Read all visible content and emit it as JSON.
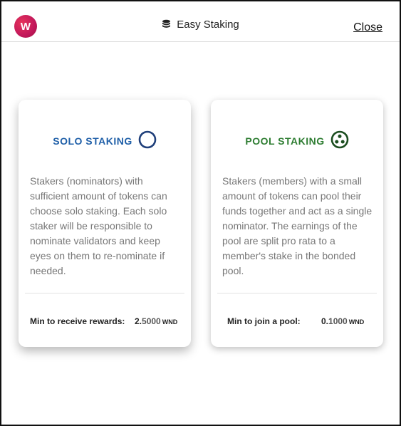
{
  "header": {
    "logo_letter": "W",
    "title": "Easy Staking",
    "close_label": "Close"
  },
  "cards": [
    {
      "title": "SOLO STAKING",
      "icon": "circle-icon",
      "color": "#1f5fa8",
      "description": "Stakers (nominators) with sufficient amount of tokens can choose solo staking. Each solo staker will be responsible to nominate validators and keep eyes on them to re-nominate if needed.",
      "footer_label": "Min to receive rewards:",
      "amount_int": "2.",
      "amount_dec": "5000",
      "unit": "WND"
    },
    {
      "title": "POOL STAKING",
      "icon": "pool-icon",
      "color": "#2e7d32",
      "description": "Stakers (members) with a small amount of tokens can pool their funds together and act as a single nominator. The earnings of the pool are split pro rata to a member's stake in the bonded pool.",
      "footer_label": "Min to join a pool:",
      "amount_int": "0.",
      "amount_dec": "1000",
      "unit": "WND"
    }
  ]
}
